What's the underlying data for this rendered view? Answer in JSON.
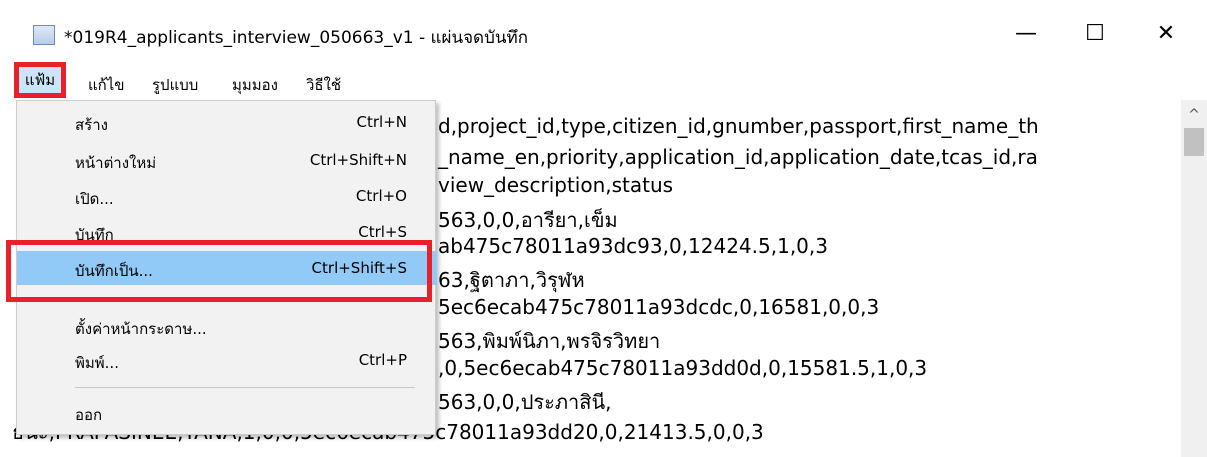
{
  "window": {
    "title": "*019R4_applicants_interview_050663_v1 - แผ่นจดบันทึก",
    "minimize_glyph": "—",
    "maximize_glyph": "☐",
    "close_glyph": "✕"
  },
  "menubar": {
    "file": "แฟ้ม",
    "edit": "แก้ไข",
    "format": "รูปแบบ",
    "view": "มุมมอง",
    "help": "วิธีใช้"
  },
  "file_menu": {
    "items": [
      {
        "label": "สร้าง",
        "shortcut": "Ctrl+N"
      },
      {
        "label": "หน้าต่างใหม่",
        "shortcut": "Ctrl+Shift+N"
      },
      {
        "label": "เปิด...",
        "shortcut": "Ctrl+O"
      },
      {
        "label": "บันทึก",
        "shortcut": "Ctrl+S"
      },
      {
        "label": "บันทึกเป็น...",
        "shortcut": "Ctrl+Shift+S"
      },
      {
        "label": "ตั้งค่าหน้ากระดาษ...",
        "shortcut": ""
      },
      {
        "label": "พิมพ์...",
        "shortcut": "Ctrl+P"
      },
      {
        "label": "ออก",
        "shortcut": ""
      }
    ]
  },
  "editor": {
    "lines": [
      "d,project_id,type,citizen_id,gnumber,passport,first_name_th",
      "_name_en,priority,application_id,application_date,tcas_id,ra",
      "view_description,status",
      "563,0,0,อารียา,เข็ม",
      "ab475c78011a93dc93,0,12424.5,1,0,3",
      "63,ฐิตาภา,วิรุฬห",
      "5ec6ecab475c78011a93dcdc,0,16581,0,0,3",
      "563,พิมพ์นิภา,พรจิรวิทยา",
      ",0,5ec6ecab475c78011a93dd0d,0,15581.5,1,0,3",
      "563,0,0,ประภาสินี,",
      "ธนะ,PRAPASINEE,TANA,1,0,0,5ec6ecab475c78011a93dd20,0,21413.5,0,0,3"
    ]
  },
  "scrollbar": {
    "up_glyph": "^"
  }
}
